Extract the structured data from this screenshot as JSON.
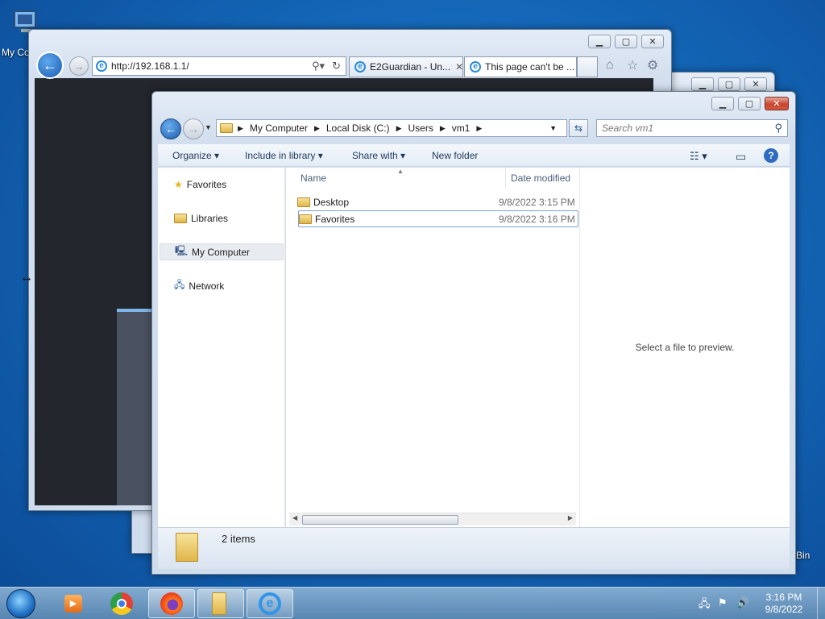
{
  "desktop": {
    "icons": [
      {
        "label": "My Co"
      },
      {
        "label": "Bin"
      }
    ]
  },
  "ie_window": {
    "address_url": "http://192.168.1.1/",
    "tabs": [
      {
        "label": "E2Guardian - Un..."
      },
      {
        "label": "This page can't be ..."
      }
    ]
  },
  "explorer": {
    "breadcrumb": [
      "My Computer",
      "Local Disk (C:)",
      "Users",
      "vm1"
    ],
    "search_placeholder": "Search vm1",
    "toolbar": {
      "organize": "Organize",
      "include_in_library": "Include in library",
      "share_with": "Share with",
      "new_folder": "New folder"
    },
    "nav": {
      "favorites": "Favorites",
      "libraries": "Libraries",
      "my_computer": "My Computer",
      "network": "Network"
    },
    "columns": {
      "name": "Name",
      "date_modified": "Date modified"
    },
    "files": [
      {
        "name": "Desktop",
        "date": "9/8/2022 3:15 PM"
      },
      {
        "name": "Favorites",
        "date": "9/8/2022 3:16 PM"
      }
    ],
    "preview_text": "Select a file to preview.",
    "status_count": "2 items"
  },
  "taskbar": {
    "clock_time": "3:16 PM",
    "clock_date": "9/8/2022",
    "apps": [
      "start-orb-icon",
      "media-player-icon",
      "chrome-icon",
      "firefox-icon",
      "explorer-icon",
      "internet-explorer-icon"
    ]
  }
}
